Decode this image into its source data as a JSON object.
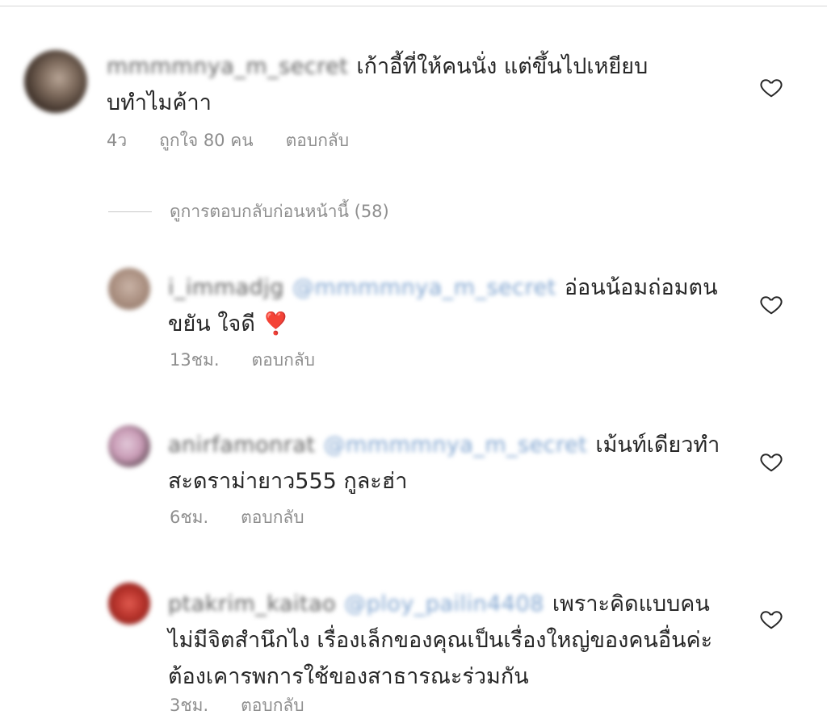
{
  "main_comment": {
    "username": "mmmmnya_m_secret",
    "text": "เก้าอี้ที่ให้คนนั่ง แต่ขึ้นไปเหยียบบทำไมค้าา",
    "time": "4ว",
    "likes": "ถูกใจ 80 คน",
    "reply_label": "ตอบกลับ"
  },
  "view_previous_replies": "ดูการตอบกลับก่อนหน้านี้ (58)",
  "replies": [
    {
      "username": "i_immadjg",
      "mention": "@mmmmnya_m_secret",
      "text": "อ่อนน้อมถ่อมตนขยัน ใจดี ❣️",
      "time": "13ชม.",
      "reply_label": "ตอบกลับ"
    },
    {
      "username": "anirfamonrat",
      "mention": "@mmmmnya_m_secret",
      "text": "เม้นท์เดียวทำสะดราม่ายาว555  กูละฮ่า",
      "time": "6ชม.",
      "reply_label": "ตอบกลับ"
    },
    {
      "username": "ptakrim_kaitao",
      "mention": "@ploy_pailin4408",
      "text": "เพราะคิดแบบคนไม่มีจิตสำนึกไง เรื่องเล็กของคุณเป็นเรื่องใหญ่ของคนอื่นค่ะ ต้องเคารพการใช้ของสาธารณะร่วมกัน",
      "time": "3ชม.",
      "reply_label": "ตอบกลับ"
    }
  ],
  "colors": {
    "text": "#262626",
    "meta": "#8e8e8e",
    "mention": "#7ea3cf",
    "heart_stroke": "#262626"
  },
  "icons": [
    "heart-outline-icon"
  ]
}
